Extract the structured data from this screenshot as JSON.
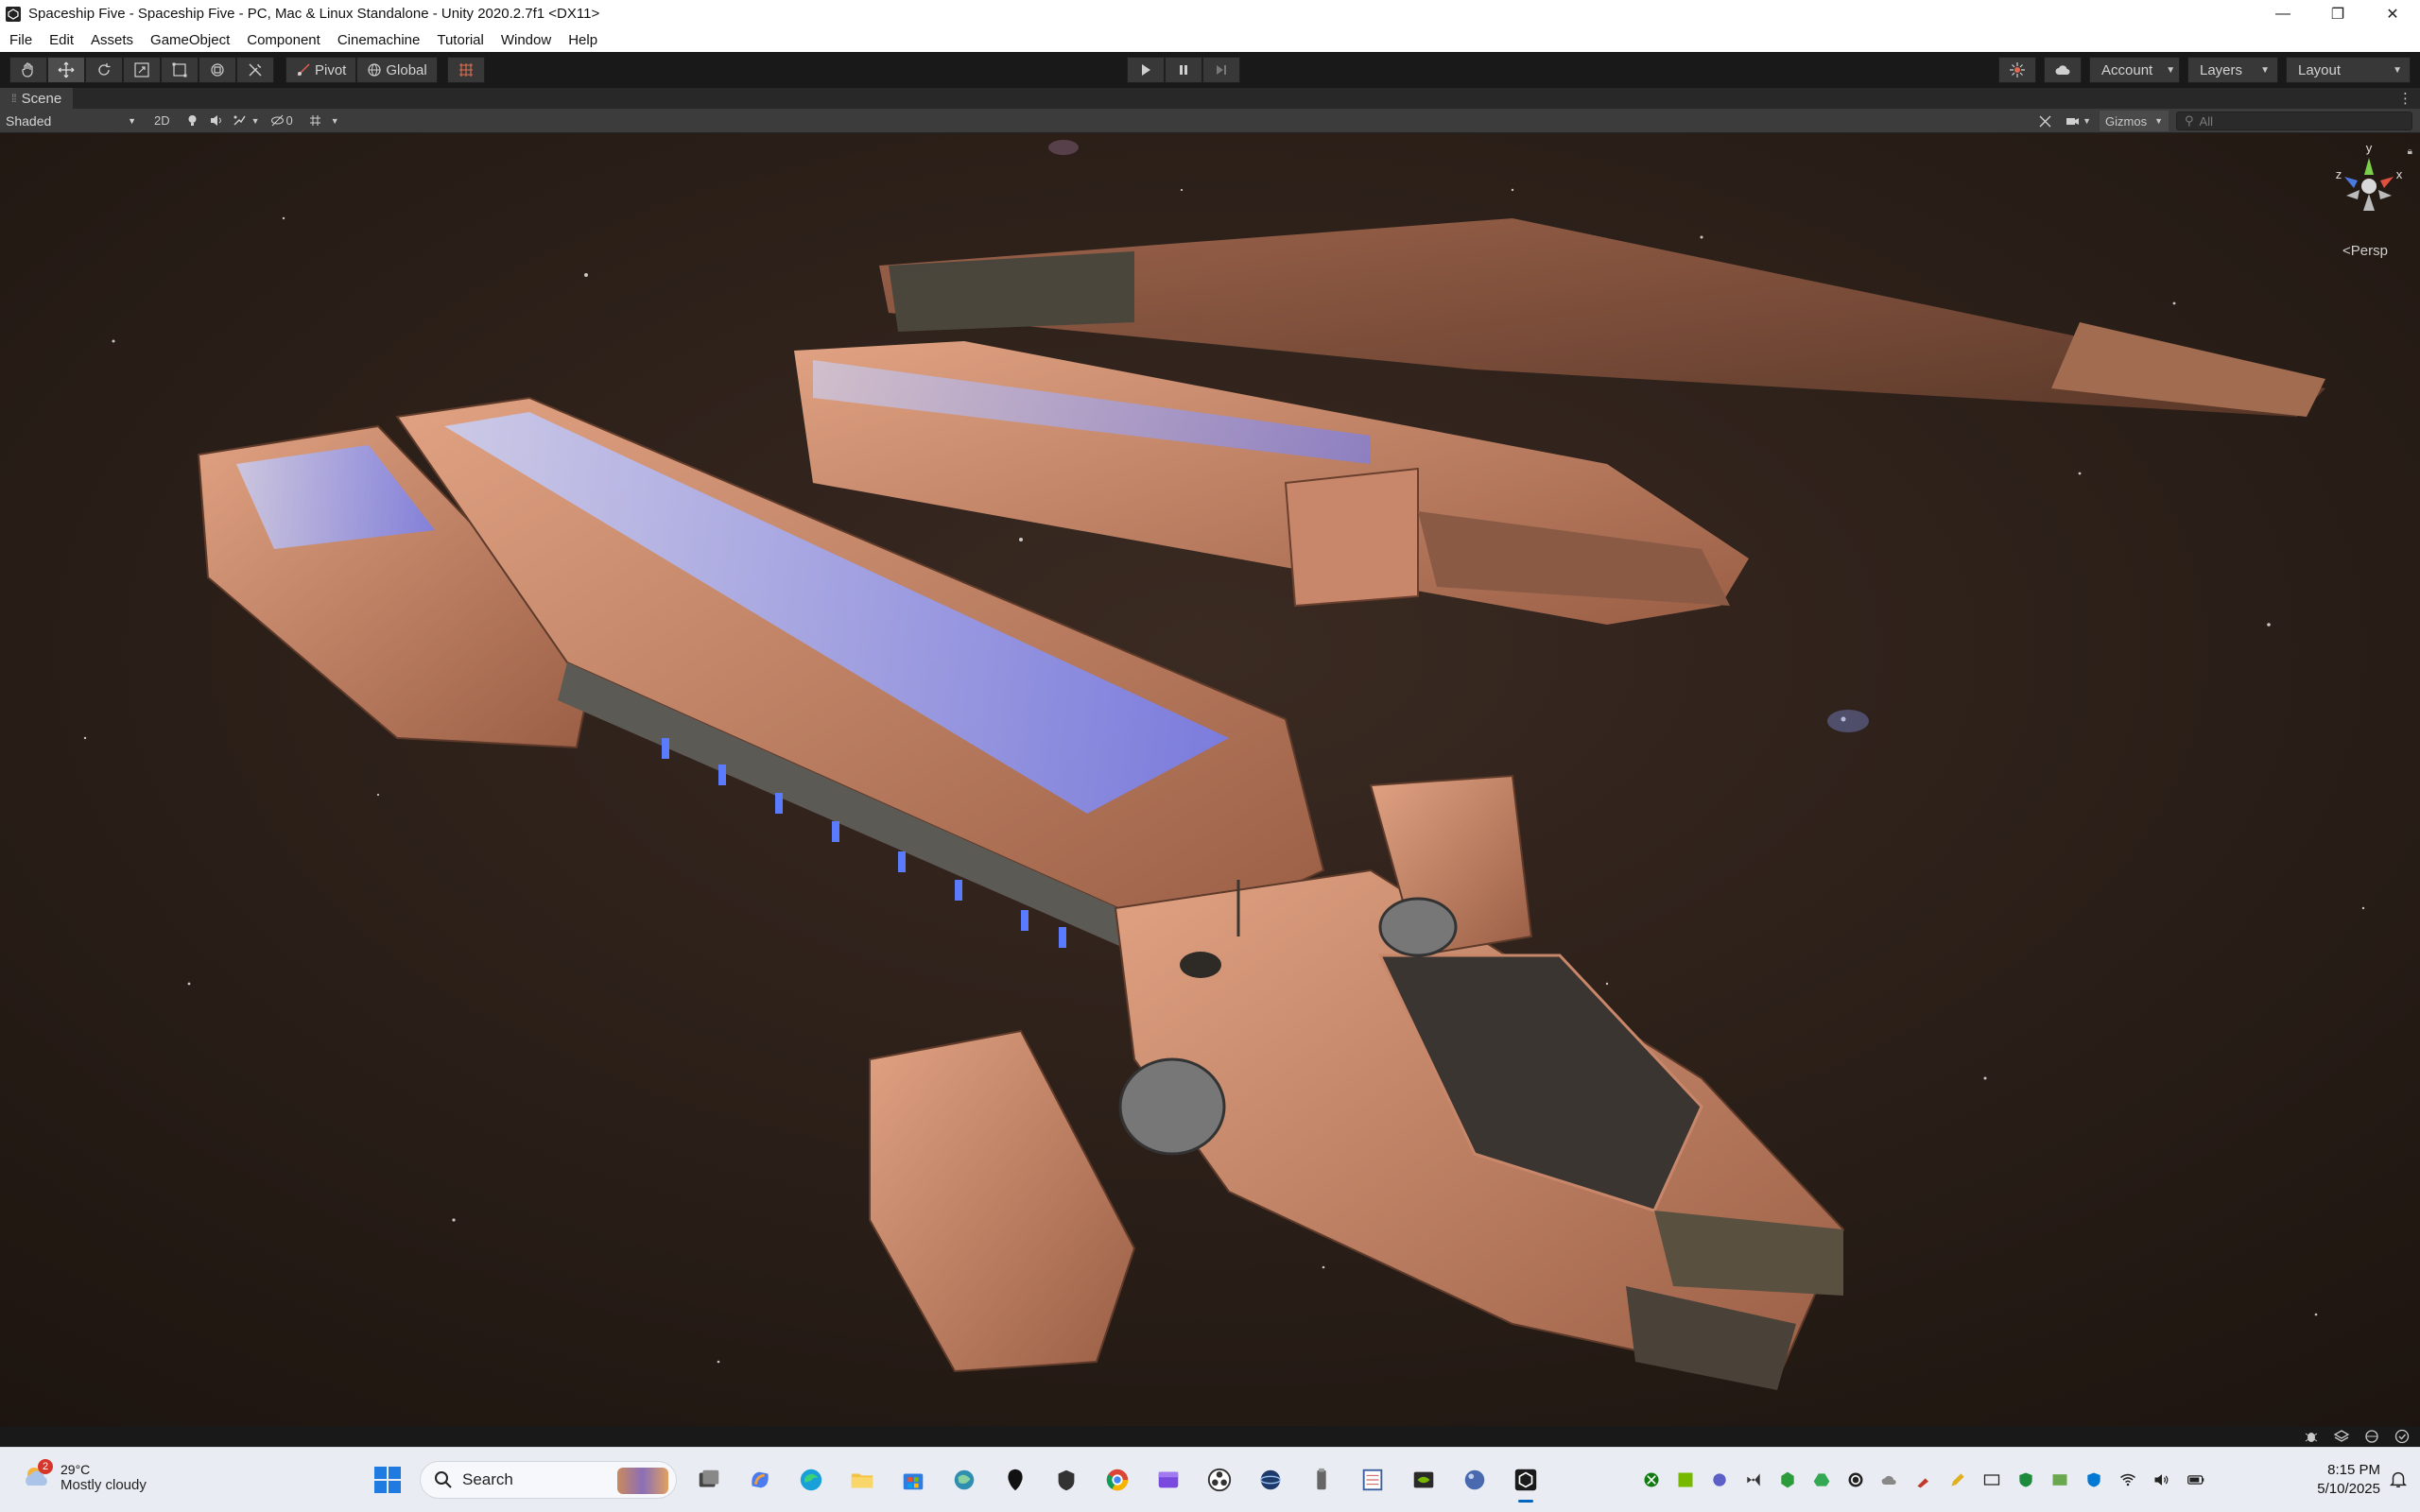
{
  "window": {
    "title": "Spaceship Five - Spaceship Five - PC, Mac & Linux Standalone - Unity 2020.2.7f1 <DX11>",
    "controls": {
      "minimize": "—",
      "maximize": "❐",
      "close": "✕"
    }
  },
  "menu": {
    "items": [
      "File",
      "Edit",
      "Assets",
      "GameObject",
      "Component",
      "Cinemachine",
      "Tutorial",
      "Window",
      "Help"
    ]
  },
  "toolbar": {
    "tools": [
      "hand-tool",
      "move-tool",
      "rotate-tool",
      "scale-tool",
      "rect-tool",
      "transform-tool",
      "custom-tool"
    ],
    "active_tool": "move-tool",
    "pivot_label": "Pivot",
    "global_label": "Global",
    "account_label": "Account",
    "layers_label": "Layers",
    "layout_label": "Layout"
  },
  "scene_tab": {
    "label": "Scene"
  },
  "scene_toolbar": {
    "shading_mode": "Shaded",
    "mode_2d": "2D",
    "hidden_count": "0",
    "gizmos_label": "Gizmos",
    "search_placeholder": "All"
  },
  "viewport": {
    "projection_label": "<Persp",
    "gizmo_axes": {
      "y": "y",
      "x": "x",
      "z": "z"
    },
    "colors": {
      "space_bg": "#2a1d16",
      "hull": "#c8876a",
      "glow": "#7a8cff"
    }
  },
  "taskbar": {
    "weather_temp": "29°C",
    "weather_condition": "Mostly cloudy",
    "weather_badge": "2",
    "search_label": "Search",
    "clock_time": "8:15 PM",
    "clock_date": "5/10/2025"
  }
}
